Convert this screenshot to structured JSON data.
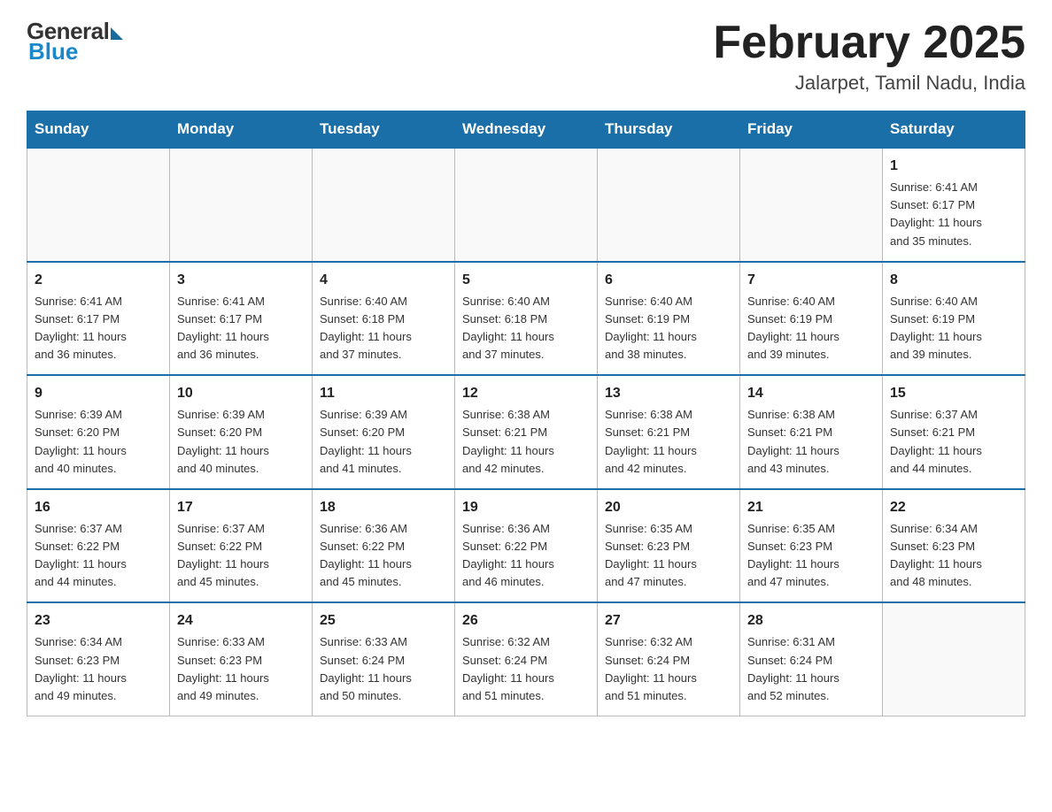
{
  "header": {
    "logo": {
      "general": "General",
      "blue": "Blue"
    },
    "title": "February 2025",
    "location": "Jalarpet, Tamil Nadu, India"
  },
  "weekdays": [
    "Sunday",
    "Monday",
    "Tuesday",
    "Wednesday",
    "Thursday",
    "Friday",
    "Saturday"
  ],
  "weeks": [
    [
      {
        "day": "",
        "info": ""
      },
      {
        "day": "",
        "info": ""
      },
      {
        "day": "",
        "info": ""
      },
      {
        "day": "",
        "info": ""
      },
      {
        "day": "",
        "info": ""
      },
      {
        "day": "",
        "info": ""
      },
      {
        "day": "1",
        "info": "Sunrise: 6:41 AM\nSunset: 6:17 PM\nDaylight: 11 hours\nand 35 minutes."
      }
    ],
    [
      {
        "day": "2",
        "info": "Sunrise: 6:41 AM\nSunset: 6:17 PM\nDaylight: 11 hours\nand 36 minutes."
      },
      {
        "day": "3",
        "info": "Sunrise: 6:41 AM\nSunset: 6:17 PM\nDaylight: 11 hours\nand 36 minutes."
      },
      {
        "day": "4",
        "info": "Sunrise: 6:40 AM\nSunset: 6:18 PM\nDaylight: 11 hours\nand 37 minutes."
      },
      {
        "day": "5",
        "info": "Sunrise: 6:40 AM\nSunset: 6:18 PM\nDaylight: 11 hours\nand 37 minutes."
      },
      {
        "day": "6",
        "info": "Sunrise: 6:40 AM\nSunset: 6:19 PM\nDaylight: 11 hours\nand 38 minutes."
      },
      {
        "day": "7",
        "info": "Sunrise: 6:40 AM\nSunset: 6:19 PM\nDaylight: 11 hours\nand 39 minutes."
      },
      {
        "day": "8",
        "info": "Sunrise: 6:40 AM\nSunset: 6:19 PM\nDaylight: 11 hours\nand 39 minutes."
      }
    ],
    [
      {
        "day": "9",
        "info": "Sunrise: 6:39 AM\nSunset: 6:20 PM\nDaylight: 11 hours\nand 40 minutes."
      },
      {
        "day": "10",
        "info": "Sunrise: 6:39 AM\nSunset: 6:20 PM\nDaylight: 11 hours\nand 40 minutes."
      },
      {
        "day": "11",
        "info": "Sunrise: 6:39 AM\nSunset: 6:20 PM\nDaylight: 11 hours\nand 41 minutes."
      },
      {
        "day": "12",
        "info": "Sunrise: 6:38 AM\nSunset: 6:21 PM\nDaylight: 11 hours\nand 42 minutes."
      },
      {
        "day": "13",
        "info": "Sunrise: 6:38 AM\nSunset: 6:21 PM\nDaylight: 11 hours\nand 42 minutes."
      },
      {
        "day": "14",
        "info": "Sunrise: 6:38 AM\nSunset: 6:21 PM\nDaylight: 11 hours\nand 43 minutes."
      },
      {
        "day": "15",
        "info": "Sunrise: 6:37 AM\nSunset: 6:21 PM\nDaylight: 11 hours\nand 44 minutes."
      }
    ],
    [
      {
        "day": "16",
        "info": "Sunrise: 6:37 AM\nSunset: 6:22 PM\nDaylight: 11 hours\nand 44 minutes."
      },
      {
        "day": "17",
        "info": "Sunrise: 6:37 AM\nSunset: 6:22 PM\nDaylight: 11 hours\nand 45 minutes."
      },
      {
        "day": "18",
        "info": "Sunrise: 6:36 AM\nSunset: 6:22 PM\nDaylight: 11 hours\nand 45 minutes."
      },
      {
        "day": "19",
        "info": "Sunrise: 6:36 AM\nSunset: 6:22 PM\nDaylight: 11 hours\nand 46 minutes."
      },
      {
        "day": "20",
        "info": "Sunrise: 6:35 AM\nSunset: 6:23 PM\nDaylight: 11 hours\nand 47 minutes."
      },
      {
        "day": "21",
        "info": "Sunrise: 6:35 AM\nSunset: 6:23 PM\nDaylight: 11 hours\nand 47 minutes."
      },
      {
        "day": "22",
        "info": "Sunrise: 6:34 AM\nSunset: 6:23 PM\nDaylight: 11 hours\nand 48 minutes."
      }
    ],
    [
      {
        "day": "23",
        "info": "Sunrise: 6:34 AM\nSunset: 6:23 PM\nDaylight: 11 hours\nand 49 minutes."
      },
      {
        "day": "24",
        "info": "Sunrise: 6:33 AM\nSunset: 6:23 PM\nDaylight: 11 hours\nand 49 minutes."
      },
      {
        "day": "25",
        "info": "Sunrise: 6:33 AM\nSunset: 6:24 PM\nDaylight: 11 hours\nand 50 minutes."
      },
      {
        "day": "26",
        "info": "Sunrise: 6:32 AM\nSunset: 6:24 PM\nDaylight: 11 hours\nand 51 minutes."
      },
      {
        "day": "27",
        "info": "Sunrise: 6:32 AM\nSunset: 6:24 PM\nDaylight: 11 hours\nand 51 minutes."
      },
      {
        "day": "28",
        "info": "Sunrise: 6:31 AM\nSunset: 6:24 PM\nDaylight: 11 hours\nand 52 minutes."
      },
      {
        "day": "",
        "info": ""
      }
    ]
  ]
}
